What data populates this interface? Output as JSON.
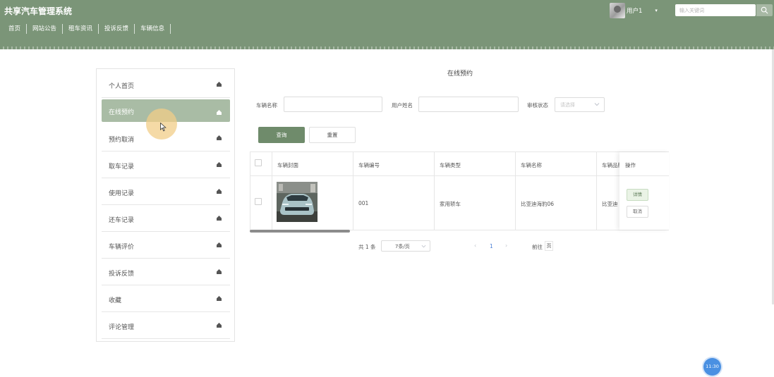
{
  "app": {
    "title": "共享汽车管理系统"
  },
  "nav": {
    "items": [
      "首页",
      "网站公告",
      "租车资讯",
      "投诉反馈",
      "车辆信息"
    ]
  },
  "user": {
    "name": "用户1"
  },
  "search": {
    "placeholder": "输入关键词"
  },
  "sidebar": {
    "items": [
      {
        "label": "个人首页"
      },
      {
        "label": "在线预约",
        "active": true
      },
      {
        "label": "预约取消"
      },
      {
        "label": "取车记录"
      },
      {
        "label": "使用记录"
      },
      {
        "label": "还车记录"
      },
      {
        "label": "车辆评价"
      },
      {
        "label": "投诉反馈"
      },
      {
        "label": "收藏"
      },
      {
        "label": "评论管理"
      }
    ]
  },
  "main": {
    "title": "在线预约",
    "filters": {
      "vehicle_name_label": "车辆名称",
      "user_name_label": "用户姓名",
      "review_status_label": "审核状态",
      "review_status_placeholder": "请选择",
      "query_button": "查询",
      "reset_button": "重置"
    },
    "table": {
      "columns": [
        "车辆封面",
        "车辆编号",
        "车辆类型",
        "车辆名称",
        "车辆品牌",
        "操作"
      ],
      "rows": [
        {
          "number": "001",
          "type": "家用轿车",
          "name": "比亚迪海豹06",
          "brand": "比亚迪",
          "actions": [
            "详情",
            "取消"
          ]
        }
      ]
    },
    "pagination": {
      "total": "共 1 条",
      "page_size": "7条/页",
      "current_page": "1",
      "goto_label": "前往",
      "goto_value": "页"
    }
  },
  "time_badge": "11:30",
  "colors": {
    "header": "#7b9578",
    "accent": "#6f8b6b",
    "active_item": "#a9bca5",
    "link": "#4a7fd6"
  }
}
